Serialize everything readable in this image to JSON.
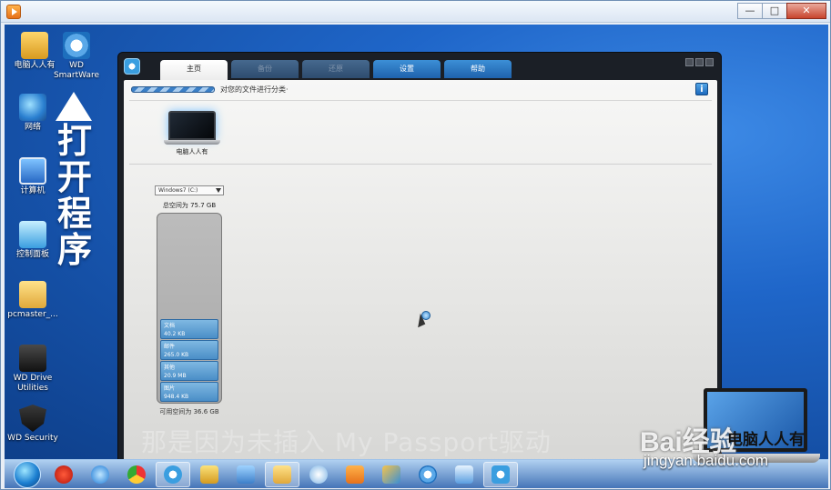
{
  "desktop": {
    "icons": [
      {
        "label": "电脑人人有"
      },
      {
        "label": "WD SmartWare"
      },
      {
        "label": "网络"
      },
      {
        "label": "计算机"
      },
      {
        "label": "控制面板"
      },
      {
        "label": "pcmaster_..."
      },
      {
        "label": "WD Drive Utilities"
      },
      {
        "label": "WD Security"
      }
    ],
    "annotation": "打开程序"
  },
  "app": {
    "tabs": [
      "主页",
      "备份",
      "还原",
      "设置",
      "帮助"
    ],
    "status_text": "对您的文件进行分类·",
    "info_button": "i",
    "device_name": "电脑人人有",
    "drive_select": "Windows7 (C:)",
    "total_space": "总空间为 75.7 GB",
    "categories": [
      {
        "name": "文档",
        "size": "40.2 KB"
      },
      {
        "name": "邮件",
        "size": "265.0 KB"
      },
      {
        "name": "其他",
        "size": "20.9 MB"
      },
      {
        "name": "图片",
        "size": "948.4 KB"
      }
    ],
    "free_space": "可用空间为 36.6 GB"
  },
  "overlay_caption": "那是因为未插入 My Passport驱动",
  "watermark": {
    "brand": "Bai经验",
    "text": "电脑人人有",
    "url": "jingyan.baidu.com"
  },
  "window_controls": {
    "minimize": "—",
    "maximize": "□",
    "close": "✕"
  }
}
